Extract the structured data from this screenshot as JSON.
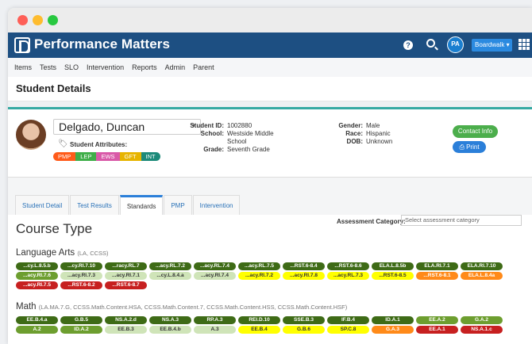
{
  "app": {
    "name": "Performance Matters",
    "help_glyph": "?",
    "user_initials": "PA",
    "site": "Boardwalk ▾"
  },
  "menu": [
    "Items",
    "Tests",
    "SLO",
    "Intervention",
    "Reports",
    "Admin",
    "Parent"
  ],
  "page_title": "Student Details",
  "student": {
    "name": "Delgado, Duncan",
    "attributes_label": "Student Attributes:",
    "attributes": [
      {
        "label": "PMP",
        "color": "#ff5b1a"
      },
      {
        "label": "LEP",
        "color": "#3fae49"
      },
      {
        "label": "EWS",
        "color": "#d959a8"
      },
      {
        "label": "GFT",
        "color": "#e7b400"
      },
      {
        "label": "INT",
        "color": "#1d8a7a"
      }
    ],
    "id_label": "Student ID:",
    "id": "1002880",
    "school_label": "School:",
    "school": "Westside Middle School",
    "grade_label": "Grade:",
    "grade": "Seventh Grade",
    "gender_label": "Gender:",
    "gender": "Male",
    "race_label": "Race:",
    "race": "Hispanic",
    "dob_label": "DOB:",
    "dob": "Unknown",
    "contact_button": "Contact Info",
    "print_button": "Print"
  },
  "tabs": [
    "Student Detail",
    "Test Results",
    "Standards",
    "PMP",
    "Intervention"
  ],
  "active_tab": "Standards",
  "course_type_title": "Course Type",
  "assessment_category": {
    "label": "Assessment Category:",
    "placeholder": "Select assessment category"
  },
  "subjects": [
    {
      "name": "Language Arts",
      "codes": "(LA, CCSS)",
      "standards": [
        {
          "code": "...cy.L.8.5.b",
          "level": "c1"
        },
        {
          "code": "...cy.RI.7.10",
          "level": "c1"
        },
        {
          "code": "...racy.RL.7",
          "level": "c1"
        },
        {
          "code": "...acy.RL.7.2",
          "level": "c1"
        },
        {
          "code": "...acy.RL.7.4",
          "level": "c1"
        },
        {
          "code": "...acy.RL.7.5",
          "level": "c1"
        },
        {
          "code": "...RST.6-8.4",
          "level": "c1"
        },
        {
          "code": "...RST.6-8.6",
          "level": "c1"
        },
        {
          "code": "ELA.L.8.5b",
          "level": "c1"
        },
        {
          "code": "ELA.RI.7.1",
          "level": "c1"
        },
        {
          "code": "ELA.RI.7.10",
          "level": "c1"
        },
        {
          "code": "...acy.RI.7.6",
          "level": "c2"
        },
        {
          "code": "...acy.RI.7.3",
          "level": "c3"
        },
        {
          "code": "...acy.RI.7.1",
          "level": "c3"
        },
        {
          "code": "...cy.L.8.4.a",
          "level": "c3"
        },
        {
          "code": "...acy.RI.7.4",
          "level": "c3"
        },
        {
          "code": "...acy.RI.7.2",
          "level": "c4"
        },
        {
          "code": "...acy.RI.7.8",
          "level": "c4"
        },
        {
          "code": "...acy.RL.7.3",
          "level": "c4"
        },
        {
          "code": "...RST.6-8.5",
          "level": "c4"
        },
        {
          "code": "...RST.6-8.1",
          "level": "c5"
        },
        {
          "code": "ELA.L.8.4a",
          "level": "c5"
        },
        {
          "code": "...acy.RI.7.5",
          "level": "c6"
        },
        {
          "code": "...RST.6-8.2",
          "level": "c6"
        },
        {
          "code": "...RST.6-8.7",
          "level": "c6"
        }
      ]
    },
    {
      "name": "Math",
      "codes": "(LA.MA.7.G, CCSS.Math.Content.HSA, CCSS.Math.Content.7, CCSS.Math.Content.HSS, CCSS.Math.Content.HSF)",
      "standards": [
        {
          "code": "EE.B.4.a",
          "level": "c1"
        },
        {
          "code": "G.B.5",
          "level": "c1"
        },
        {
          "code": "NS.A.2.d",
          "level": "c1"
        },
        {
          "code": "NS.A.3",
          "level": "c1"
        },
        {
          "code": "RP.A.3",
          "level": "c1"
        },
        {
          "code": "REI.D.10",
          "level": "c1"
        },
        {
          "code": "SSE.B.3",
          "level": "c1"
        },
        {
          "code": "IF.B.4",
          "level": "c1"
        },
        {
          "code": "ID.A.1",
          "level": "c1"
        },
        {
          "code": "EE.A.2",
          "level": "c2"
        },
        {
          "code": "G.A.2",
          "level": "c2"
        },
        {
          "code": "A.2",
          "level": "c2"
        },
        {
          "code": "ID.A.2",
          "level": "c2"
        },
        {
          "code": "EE.B.3",
          "level": "c3"
        },
        {
          "code": "EE.B.4.b",
          "level": "c3"
        },
        {
          "code": "A.3",
          "level": "c3"
        },
        {
          "code": "EE.B.4",
          "level": "c4"
        },
        {
          "code": "G.B.6",
          "level": "c4"
        },
        {
          "code": "SP.C.8",
          "level": "c4"
        },
        {
          "code": "G.A.3",
          "level": "c5"
        },
        {
          "code": "EE.A.1",
          "level": "c6"
        },
        {
          "code": "NS.A.1.c",
          "level": "c6"
        }
      ]
    }
  ]
}
